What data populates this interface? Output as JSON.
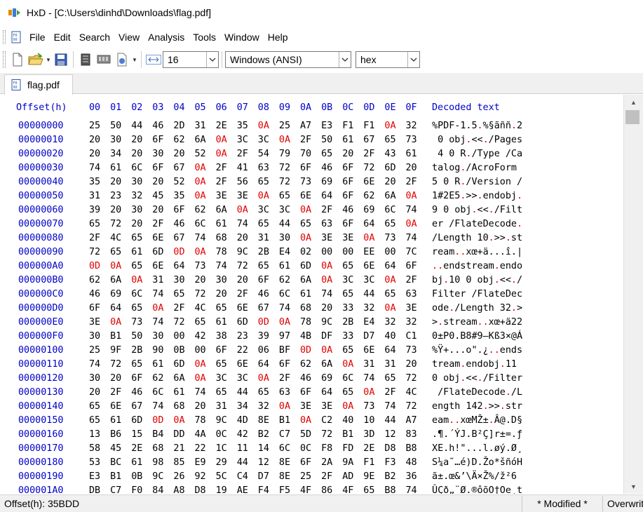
{
  "window": {
    "title": "HxD - [C:\\Users\\dinhd\\Downloads\\flag.pdf]"
  },
  "menu": {
    "items": [
      "File",
      "Edit",
      "Search",
      "View",
      "Analysis",
      "Tools",
      "Window",
      "Help"
    ]
  },
  "toolbar": {
    "bytes_per_row": "16",
    "charset": "Windows (ANSI)",
    "display_mode": "hex"
  },
  "tab": {
    "label": "flag.pdf"
  },
  "hex_header": {
    "offset_label": "Offset(h)",
    "columns": [
      "00",
      "01",
      "02",
      "03",
      "04",
      "05",
      "06",
      "07",
      "08",
      "09",
      "0A",
      "0B",
      "0C",
      "0D",
      "0E",
      "0F"
    ],
    "decoded_label": "Decoded text"
  },
  "rows": [
    {
      "offset": "00000000",
      "bytes": [
        "25",
        "50",
        "44",
        "46",
        "2D",
        "31",
        "2E",
        "35",
        "0A",
        "25",
        "A7",
        "E3",
        "F1",
        "F1",
        "0A",
        "32"
      ],
      "text": "%PDF-1.5.%§ãññ.2"
    },
    {
      "offset": "00000010",
      "bytes": [
        "20",
        "30",
        "20",
        "6F",
        "62",
        "6A",
        "0A",
        "3C",
        "3C",
        "0A",
        "2F",
        "50",
        "61",
        "67",
        "65",
        "73"
      ],
      "text": " 0 obj.<<./Pages"
    },
    {
      "offset": "00000020",
      "bytes": [
        "20",
        "34",
        "20",
        "30",
        "20",
        "52",
        "0A",
        "2F",
        "54",
        "79",
        "70",
        "65",
        "20",
        "2F",
        "43",
        "61"
      ],
      "text": " 4 0 R./Type /Ca"
    },
    {
      "offset": "00000030",
      "bytes": [
        "74",
        "61",
        "6C",
        "6F",
        "67",
        "0A",
        "2F",
        "41",
        "63",
        "72",
        "6F",
        "46",
        "6F",
        "72",
        "6D",
        "20"
      ],
      "text": "talog./AcroForm "
    },
    {
      "offset": "00000040",
      "bytes": [
        "35",
        "20",
        "30",
        "20",
        "52",
        "0A",
        "2F",
        "56",
        "65",
        "72",
        "73",
        "69",
        "6F",
        "6E",
        "20",
        "2F"
      ],
      "text": "5 0 R./Version /"
    },
    {
      "offset": "00000050",
      "bytes": [
        "31",
        "23",
        "32",
        "45",
        "35",
        "0A",
        "3E",
        "3E",
        "0A",
        "65",
        "6E",
        "64",
        "6F",
        "62",
        "6A",
        "0A"
      ],
      "text": "1#2E5.>>.endobj."
    },
    {
      "offset": "00000060",
      "bytes": [
        "39",
        "20",
        "30",
        "20",
        "6F",
        "62",
        "6A",
        "0A",
        "3C",
        "3C",
        "0A",
        "2F",
        "46",
        "69",
        "6C",
        "74"
      ],
      "text": "9 0 obj.<<./Filt"
    },
    {
      "offset": "00000070",
      "bytes": [
        "65",
        "72",
        "20",
        "2F",
        "46",
        "6C",
        "61",
        "74",
        "65",
        "44",
        "65",
        "63",
        "6F",
        "64",
        "65",
        "0A"
      ],
      "text": "er /FlateDecode."
    },
    {
      "offset": "00000080",
      "bytes": [
        "2F",
        "4C",
        "65",
        "6E",
        "67",
        "74",
        "68",
        "20",
        "31",
        "30",
        "0A",
        "3E",
        "3E",
        "0A",
        "73",
        "74"
      ],
      "text": "/Length 10.>>.st"
    },
    {
      "offset": "00000090",
      "bytes": [
        "72",
        "65",
        "61",
        "6D",
        "0D",
        "0A",
        "78",
        "9C",
        "2B",
        "E4",
        "02",
        "00",
        "00",
        "EE",
        "00",
        "7C"
      ],
      "text": "ream..xœ+ä...î.|"
    },
    {
      "offset": "000000A0",
      "bytes": [
        "0D",
        "0A",
        "65",
        "6E",
        "64",
        "73",
        "74",
        "72",
        "65",
        "61",
        "6D",
        "0A",
        "65",
        "6E",
        "64",
        "6F"
      ],
      "text": "..endstream.endo"
    },
    {
      "offset": "000000B0",
      "bytes": [
        "62",
        "6A",
        "0A",
        "31",
        "30",
        "20",
        "30",
        "20",
        "6F",
        "62",
        "6A",
        "0A",
        "3C",
        "3C",
        "0A",
        "2F"
      ],
      "text": "bj.10 0 obj.<<./"
    },
    {
      "offset": "000000C0",
      "bytes": [
        "46",
        "69",
        "6C",
        "74",
        "65",
        "72",
        "20",
        "2F",
        "46",
        "6C",
        "61",
        "74",
        "65",
        "44",
        "65",
        "63"
      ],
      "text": "Filter /FlateDec"
    },
    {
      "offset": "000000D0",
      "bytes": [
        "6F",
        "64",
        "65",
        "0A",
        "2F",
        "4C",
        "65",
        "6E",
        "67",
        "74",
        "68",
        "20",
        "33",
        "32",
        "0A",
        "3E"
      ],
      "text": "ode./Length 32.>"
    },
    {
      "offset": "000000E0",
      "bytes": [
        "3E",
        "0A",
        "73",
        "74",
        "72",
        "65",
        "61",
        "6D",
        "0D",
        "0A",
        "78",
        "9C",
        "2B",
        "E4",
        "32",
        "32"
      ],
      "text": ">.stream..xœ+ä22"
    },
    {
      "offset": "000000F0",
      "bytes": [
        "30",
        "B1",
        "50",
        "30",
        "00",
        "42",
        "38",
        "23",
        "39",
        "97",
        "4B",
        "DF",
        "33",
        "D7",
        "40",
        "C1"
      ],
      "text": "0±P0.B8#9—Kß3×@Á"
    },
    {
      "offset": "00000100",
      "bytes": [
        "25",
        "9F",
        "2B",
        "90",
        "0B",
        "00",
        "6F",
        "22",
        "06",
        "BF",
        "0D",
        "0A",
        "65",
        "6E",
        "64",
        "73"
      ],
      "text": "%Ÿ+...o\".¿..ends"
    },
    {
      "offset": "00000110",
      "bytes": [
        "74",
        "72",
        "65",
        "61",
        "6D",
        "0A",
        "65",
        "6E",
        "64",
        "6F",
        "62",
        "6A",
        "0A",
        "31",
        "31",
        "20"
      ],
      "text": "tream.endobj.11 "
    },
    {
      "offset": "00000120",
      "bytes": [
        "30",
        "20",
        "6F",
        "62",
        "6A",
        "0A",
        "3C",
        "3C",
        "0A",
        "2F",
        "46",
        "69",
        "6C",
        "74",
        "65",
        "72"
      ],
      "text": "0 obj.<<./Filter"
    },
    {
      "offset": "00000130",
      "bytes": [
        "20",
        "2F",
        "46",
        "6C",
        "61",
        "74",
        "65",
        "44",
        "65",
        "63",
        "6F",
        "64",
        "65",
        "0A",
        "2F",
        "4C"
      ],
      "text": " /FlateDecode./L"
    },
    {
      "offset": "00000140",
      "bytes": [
        "65",
        "6E",
        "67",
        "74",
        "68",
        "20",
        "31",
        "34",
        "32",
        "0A",
        "3E",
        "3E",
        "0A",
        "73",
        "74",
        "72"
      ],
      "text": "ength 142.>>.str"
    },
    {
      "offset": "00000150",
      "bytes": [
        "65",
        "61",
        "6D",
        "0D",
        "0A",
        "78",
        "9C",
        "4D",
        "8E",
        "B1",
        "0A",
        "C2",
        "40",
        "10",
        "44",
        "A7"
      ],
      "text": "eam..xœMŽ±.Â@.D§"
    },
    {
      "offset": "00000160",
      "bytes": [
        "13",
        "B6",
        "15",
        "B4",
        "DD",
        "4A",
        "0C",
        "42",
        "B2",
        "C7",
        "5D",
        "72",
        "B1",
        "3D",
        "12",
        "83"
      ],
      "text": ".¶.´ÝJ.B²Ç]r±=.ƒ"
    },
    {
      "offset": "00000170",
      "bytes": [
        "58",
        "45",
        "2E",
        "68",
        "21",
        "22",
        "1C",
        "11",
        "14",
        "6C",
        "0C",
        "F8",
        "FD",
        "2E",
        "D8",
        "B8"
      ],
      "text": "XE.h!\"...l.øý.Ø¸"
    },
    {
      "offset": "00000180",
      "bytes": [
        "53",
        "BC",
        "61",
        "98",
        "85",
        "E9",
        "29",
        "44",
        "12",
        "8E",
        "6F",
        "2A",
        "9A",
        "F1",
        "F3",
        "48"
      ],
      "text": "S¼a˜…é)D.Žo*šñóH"
    },
    {
      "offset": "00000190",
      "bytes": [
        "E3",
        "B1",
        "0B",
        "9C",
        "26",
        "92",
        "5C",
        "C4",
        "D7",
        "8E",
        "25",
        "2F",
        "AD",
        "9E",
        "B2",
        "36"
      ],
      "text": "ã±.œ&’\\Ä×Ž%/­ž²6"
    },
    {
      "offset": "000001A0",
      "bytes": [
        "DB",
        "C7",
        "F0",
        "84",
        "A8",
        "D8",
        "19",
        "AE",
        "F4",
        "F5",
        "4F",
        "86",
        "4F",
        "65",
        "B8",
        "74"
      ],
      "text": "ÛÇð„¨Ø.®ôõO†Oe¸t"
    }
  ],
  "status": {
    "offset": "Offset(h): 35BDD",
    "modified": "* Modified *",
    "mode": "Overwrite"
  }
}
